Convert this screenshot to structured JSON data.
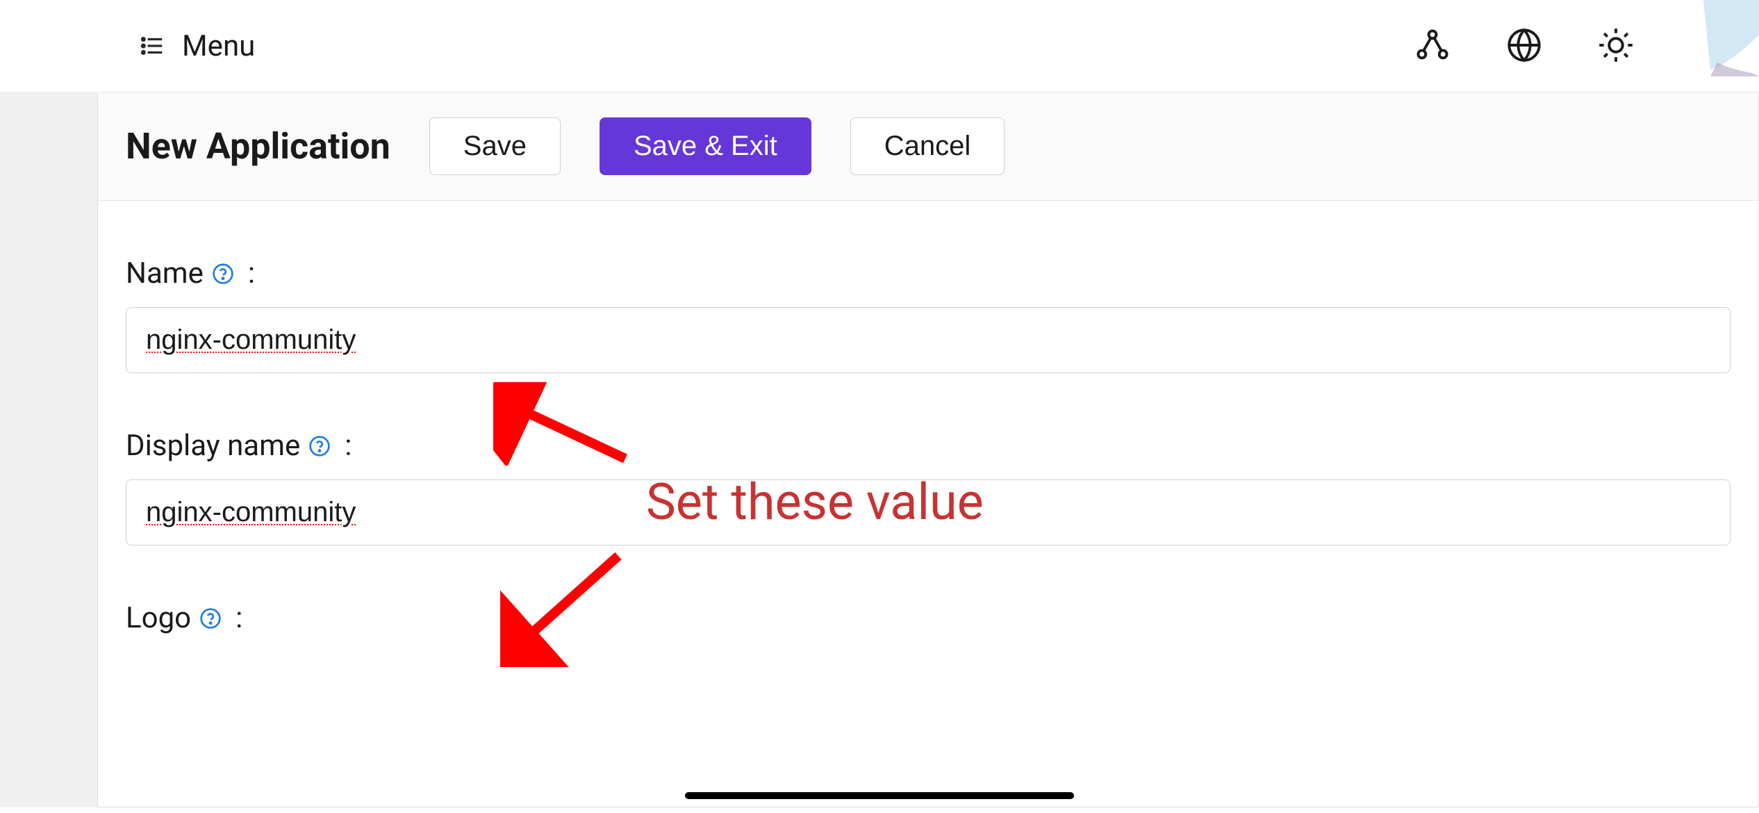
{
  "nav": {
    "menu_label": "Menu"
  },
  "header": {
    "title": "New Application",
    "save_label": "Save",
    "save_exit_label": "Save & Exit",
    "cancel_label": "Cancel"
  },
  "form": {
    "name": {
      "label": "Name",
      "value": "nginx-community"
    },
    "display_name": {
      "label": "Display name",
      "value": "nginx-community"
    },
    "logo": {
      "label": "Logo"
    }
  },
  "annotation": {
    "text": "Set these value"
  },
  "colors": {
    "primary": "#6536d8",
    "annotation_red": "#c83232",
    "help_icon_blue": "#1e7be0"
  }
}
